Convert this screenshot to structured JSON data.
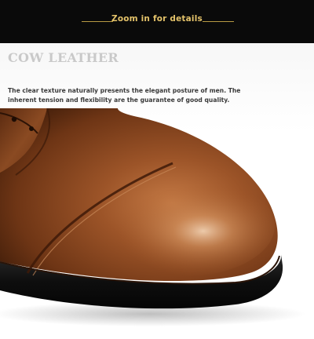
{
  "banner": {
    "text": "Zoom in for details"
  },
  "section": {
    "heading": "COW LEATHER",
    "description_lines": [
      "The clear texture naturally presents the elegant posture of men. The",
      "inherent tension and flexibility are the guarantee of good quality."
    ]
  },
  "colors": {
    "banner_bg": "#0a0a0a",
    "banner_text": "#e3c26a",
    "heading": "#c9c9c9",
    "leather": "#8a4a22",
    "sole": "#111111"
  },
  "image": {
    "subject": "close-up-of-brown-leather-shoe-toe"
  }
}
